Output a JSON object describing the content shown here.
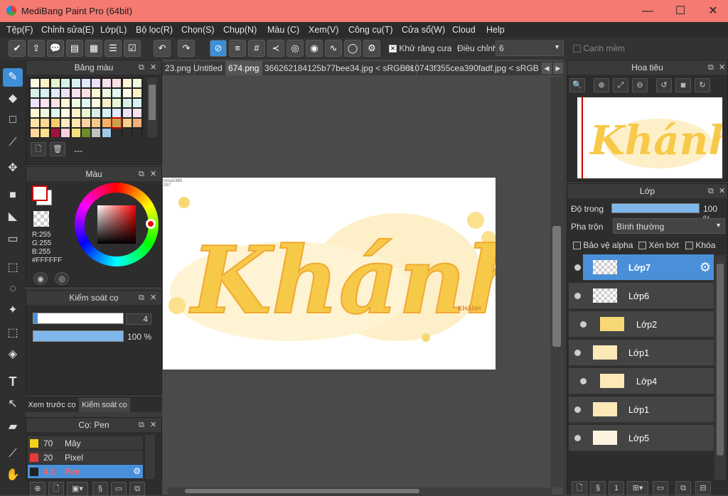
{
  "app": {
    "title": "MediBang Paint Pro (64bit)",
    "minimize": "—",
    "maximize": "☐",
    "close": "✕"
  },
  "menu": [
    "Tệp(F)",
    "Chỉnh sửa(E)",
    "Lớp(L)",
    "Bộ lọc(R)",
    "Chọn(S)",
    "Chụp(N)",
    "Màu (C)",
    "Xem(V)",
    "Công cụ(T)",
    "Cửa sổ(W)",
    "Cloud",
    "Help"
  ],
  "toolbar": {
    "antialias_label": "Khử răng cưa",
    "adjust_label": "Điều chỉnh",
    "adjust_value": "6",
    "soft_edge_label": "Cạnh mềm"
  },
  "tabs": [
    "23.png",
    "Untitled",
    "674.png",
    "366262184125b77bee34.jpg < sRGB >",
    "610743f355cea390fadf.jpg < sRGB >"
  ],
  "palette_panel": {
    "title": "Bảng màu",
    "name_value": "---"
  },
  "color_panel": {
    "title": "Màu",
    "r": "R:255",
    "g": "G:255",
    "b": "B:255",
    "hex": "#FFFFFF"
  },
  "brush_control": {
    "title": "Kiểm soát cọ",
    "size_value": "4",
    "opacity_value": "100 %",
    "opacity_fraction": 1.0
  },
  "bottom_tabs": [
    "Xem trước cọ",
    "Kiểm soát cọ"
  ],
  "brush_panel": {
    "title": "Cọ: Pen",
    "items": [
      {
        "size": "70",
        "name": "Mây",
        "color": "#f2d21b"
      },
      {
        "size": "20",
        "name": "Pixel",
        "color": "#e53a3a"
      },
      {
        "size": "4.0",
        "name": "Pen",
        "color": "#222222"
      }
    ]
  },
  "navigator": {
    "title": "Hoa tiêu"
  },
  "layer_panel": {
    "title": "Lớp",
    "opacity_label": "Độ trong",
    "opacity_value": "100 %",
    "opacity_fraction": 1.0,
    "blend_label": "Pha trộn",
    "blend_value": "Bình thường",
    "protect_alpha": "Bảo vệ alpha",
    "clip": "Xén bớt",
    "lock": "Khóa",
    "layers": [
      "Lớp7",
      "Lớp6",
      "Lớp2",
      "Lớp1",
      "Lớp4",
      "Lớp1",
      "Lớp5"
    ]
  },
  "canvas": {
    "artwork_text": "Khánh",
    "signature_text": "KHÁNH",
    "corner_text_1": "nmai1985",
    "corner_text_2": "257"
  },
  "colors": {
    "accent": "#3d8fd6",
    "titlebar": "#f47a72",
    "art_yellow": "#f7c948"
  }
}
